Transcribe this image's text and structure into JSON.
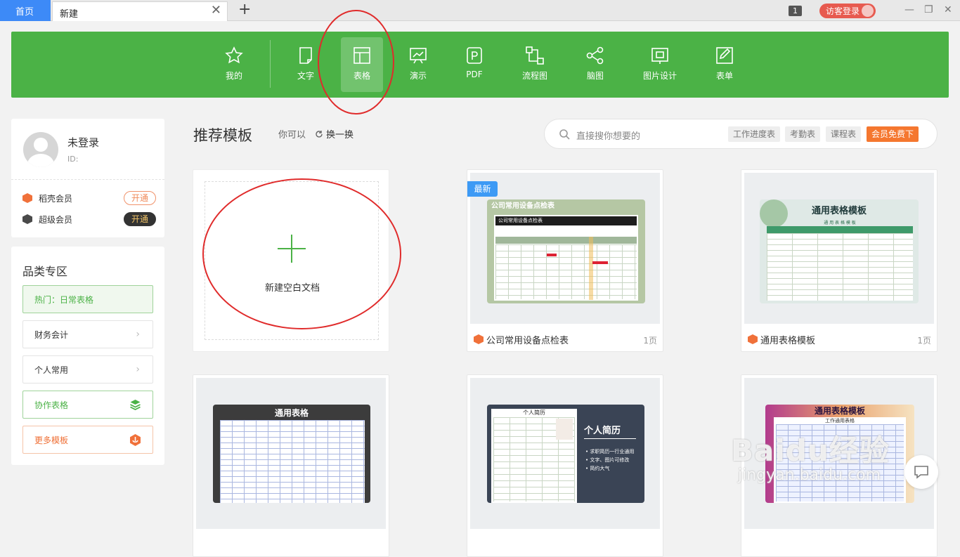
{
  "tabs": {
    "home": "首页",
    "new": "新建",
    "close": "✕",
    "add": "+"
  },
  "window": {
    "badge": "1",
    "visitor_login": "访客登录",
    "minimize": "—",
    "restore": "❐",
    "close": "✕"
  },
  "toolbar": {
    "items": [
      {
        "label": "我的",
        "icon": "star-icon"
      },
      {
        "label": "文字",
        "icon": "document-icon"
      },
      {
        "label": "表格",
        "icon": "spreadsheet-icon"
      },
      {
        "label": "演示",
        "icon": "presentation-icon"
      },
      {
        "label": "PDF",
        "icon": "pdf-icon"
      },
      {
        "label": "流程图",
        "icon": "flowchart-icon"
      },
      {
        "label": "脑图",
        "icon": "mindmap-icon"
      },
      {
        "label": "图片设计",
        "icon": "image-design-icon"
      },
      {
        "label": "表单",
        "icon": "form-icon"
      }
    ],
    "active": "表格"
  },
  "user": {
    "name": "未登录",
    "id": "ID:",
    "vips": [
      {
        "label": "稻壳会员",
        "button": "开通",
        "color": "#f0713a"
      },
      {
        "label": "超级会员",
        "button": "开通",
        "color": "#4a4a4a"
      }
    ]
  },
  "categories": {
    "title": "品类专区",
    "items": [
      "热门：日常表格",
      "财务会计",
      "个人常用",
      "协作表格",
      "更多模板"
    ]
  },
  "recommend": {
    "title": "推荐模板",
    "hint": "你可以",
    "refresh": "换一换"
  },
  "search": {
    "placeholder": "直接搜你想要的",
    "tags": [
      "工作进度表",
      "考勤表",
      "课程表"
    ],
    "vip_tag": "会员免费下"
  },
  "new_blank": {
    "label": "新建空白文档"
  },
  "templates": [
    {
      "name": "公司常用设备点检表",
      "pages": "1页",
      "badge": "最新",
      "sheet_title": "公司常用设备点检表",
      "sheet_sub": "公司常用设备点检表"
    },
    {
      "name": "通用表格模板",
      "pages": "1页",
      "sheet_title": "通用表格模板",
      "sheet_sub": "通 用 表 格 模 板"
    },
    {
      "sheet_title": "通用表格"
    },
    {
      "sheet_title": "个人简历",
      "sheet_sub": "个人简历",
      "bullets": [
        "求职简历一行业通用",
        "文字、图片可修改",
        "简约大气"
      ]
    },
    {
      "sheet_title": "通用表格模板",
      "sheet_sub": "工作通用表格"
    }
  ],
  "watermark": {
    "main": "Baidu经验",
    "sub": "jingyan.baidu.com"
  },
  "colors": {
    "brand_green": "#4bb246",
    "tab_blue": "#3d8af7",
    "annotation_red": "#e02b2b",
    "vip_orange": "#f5772f"
  }
}
